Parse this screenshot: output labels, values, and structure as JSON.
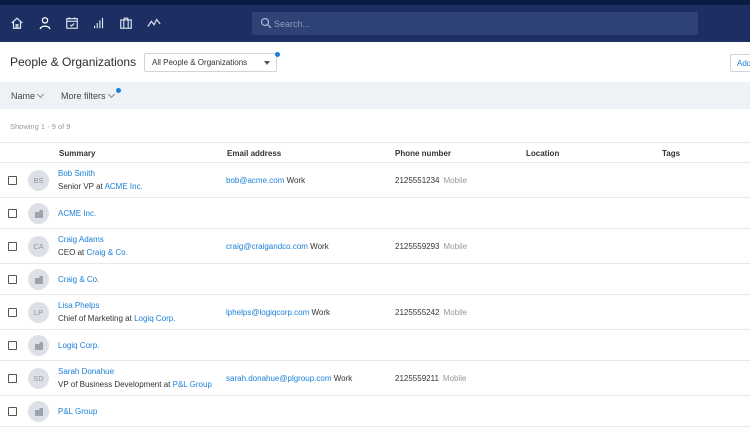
{
  "search": {
    "placeholder": "Search..."
  },
  "nav": [
    "home-icon",
    "person-icon",
    "calendar-icon",
    "bar-chart-icon",
    "briefcase-icon",
    "activity-icon"
  ],
  "header": {
    "title": "People & Organizations",
    "filter_value": "All People & Organizations",
    "add_label": "Add"
  },
  "filterbar": {
    "name_label": "Name",
    "more_filters_label": "More filters"
  },
  "showing": "Showing 1 - 9 of 9",
  "columns": {
    "summary": "Summary",
    "email": "Email address",
    "phone": "Phone number",
    "location": "Location",
    "tags": "Tags"
  },
  "rows": [
    {
      "kind": "person",
      "initials": "BS",
      "name": "Bob Smith",
      "title": "Senior VP",
      "at": "at",
      "org": "ACME Inc.",
      "email": "bob@acme.com",
      "email_type": "Work",
      "phone": "2125551234",
      "phone_type": "Mobile"
    },
    {
      "kind": "org",
      "name": "ACME Inc."
    },
    {
      "kind": "person",
      "initials": "CA",
      "name": "Craig Adams",
      "title": "CEO",
      "at": "at",
      "org": "Craig & Co.",
      "email": "craig@craigandco.com",
      "email_type": "Work",
      "phone": "2125559293",
      "phone_type": "Mobile"
    },
    {
      "kind": "org",
      "name": "Craig & Co."
    },
    {
      "kind": "person",
      "initials": "LP",
      "name": "Lisa Phelps",
      "title": "Chief of Marketing",
      "at": "at",
      "org": "Logiq Corp.",
      "email": "lphelps@logiqcorp.com",
      "email_type": "Work",
      "phone": "2125555242",
      "phone_type": "Mobile"
    },
    {
      "kind": "org",
      "name": "Logiq Corp."
    },
    {
      "kind": "person",
      "initials": "SD",
      "name": "Sarah Donahue",
      "title": "VP of Business Development",
      "at": "at",
      "org": "P&L Group",
      "email": "sarah.donahue@plgroup.com",
      "email_type": "Work",
      "phone": "2125559211",
      "phone_type": "Mobile"
    },
    {
      "kind": "org",
      "name": "P&L Group"
    }
  ]
}
